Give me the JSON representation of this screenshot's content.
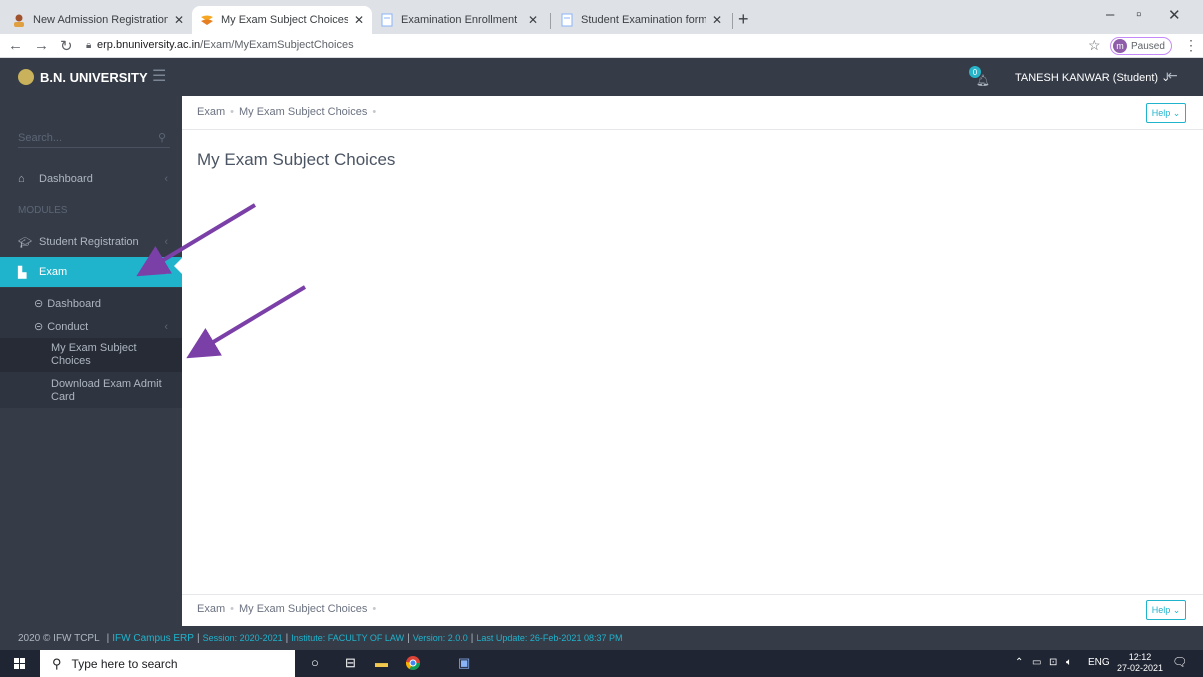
{
  "browser": {
    "tabs": [
      {
        "title": "New Admission Registration Forı",
        "active": false
      },
      {
        "title": "My Exam Subject Choices - IFW (",
        "active": true
      },
      {
        "title": "Examination Enrollment",
        "active": false
      },
      {
        "title": "Student Examination form withou",
        "active": false
      }
    ],
    "new_tab": "+",
    "url_domain": "erp.bnuniversity.ac.in",
    "url_path": "/Exam/MyExamSubjectChoices",
    "profile_initial": "m",
    "profile_status": "Paused"
  },
  "app": {
    "brand": "B.N. UNIVERSITY",
    "notification_count": "0",
    "user": "TANESH KANWAR (Student)",
    "search_placeholder": "Search...",
    "modules_label": "MODULES",
    "nav": {
      "dashboard": "Dashboard",
      "student_registration": "Student Registration",
      "exam": "Exam",
      "exam_dashboard": "Dashboard",
      "conduct": "Conduct",
      "my_exam_subject_choices": "My Exam Subject Choices",
      "download_admit_card": "Download Exam Admit Card"
    },
    "breadcrumb": [
      "Exam",
      "My Exam Subject Choices"
    ],
    "help": "Help",
    "page_title": "My Exam Subject Choices",
    "footer": {
      "copyright": "2020 © IFW TCPL",
      "app_name": "IFW Campus ERP",
      "session": "Session: 2020-2021",
      "institute": "Institute: FACULTY OF LAW",
      "version": "Version: 2.0.0",
      "last_update": "Last Update: 26-Feb-2021 08:37 PM"
    }
  },
  "taskbar": {
    "search_placeholder": "Type here to search",
    "lang": "ENG",
    "time": "12:12",
    "date": "27-02-2021",
    "notif_count": "8"
  },
  "colors": {
    "accent": "#1fb3cc",
    "sidebar": "#353c48",
    "annotation_arrow": "#7b3fa8"
  }
}
